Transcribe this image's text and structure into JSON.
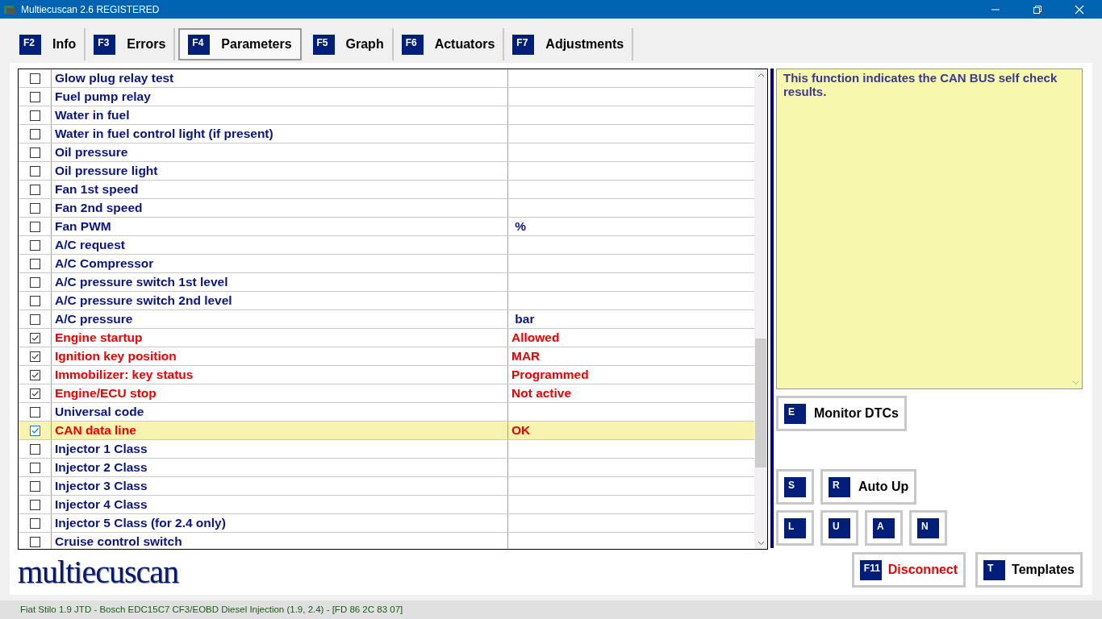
{
  "window": {
    "title": "Multiecuscan 2.6 REGISTERED"
  },
  "tabs": [
    {
      "key": "F2",
      "label": "Info",
      "selected": false
    },
    {
      "key": "F3",
      "label": "Errors",
      "selected": false
    },
    {
      "key": "F4",
      "label": "Parameters",
      "selected": true
    },
    {
      "key": "F5",
      "label": "Graph",
      "selected": false
    },
    {
      "key": "F6",
      "label": "Actuators",
      "selected": false
    },
    {
      "key": "F7",
      "label": "Adjustments",
      "selected": false
    }
  ],
  "parameters": [
    {
      "name": "Glow plug relay test",
      "checked": false,
      "selected": false
    },
    {
      "name": "Fuel pump relay",
      "checked": false,
      "selected": false
    },
    {
      "name": "Water in fuel",
      "checked": false,
      "selected": false
    },
    {
      "name": "Water in fuel control light (if present)",
      "checked": false,
      "selected": false
    },
    {
      "name": "Oil pressure",
      "checked": false,
      "selected": false
    },
    {
      "name": "Oil pressure light",
      "checked": false,
      "selected": false
    },
    {
      "name": "Fan 1st speed",
      "checked": false,
      "selected": false
    },
    {
      "name": "Fan 2nd speed",
      "checked": false,
      "selected": false
    },
    {
      "name": "Fan PWM",
      "value": " %",
      "checked": false,
      "selected": false
    },
    {
      "name": "A/C request",
      "checked": false,
      "selected": false
    },
    {
      "name": "A/C Compressor",
      "checked": false,
      "selected": false
    },
    {
      "name": "A/C pressure switch 1st level",
      "checked": false,
      "selected": false
    },
    {
      "name": "A/C pressure switch 2nd level",
      "checked": false,
      "selected": false
    },
    {
      "name": "A/C pressure",
      "value": " bar",
      "checked": false,
      "selected": false
    },
    {
      "name": "Engine startup",
      "value": "Allowed",
      "checked": true,
      "selected": false
    },
    {
      "name": "Ignition key position",
      "value": "MAR",
      "checked": true,
      "selected": false
    },
    {
      "name": "Immobilizer: key status",
      "value": "Programmed",
      "checked": true,
      "selected": false
    },
    {
      "name": "Engine/ECU stop",
      "value": "Not active",
      "checked": true,
      "selected": false
    },
    {
      "name": "Universal code",
      "checked": false,
      "selected": false
    },
    {
      "name": "CAN data line",
      "value": "OK",
      "checked": true,
      "selected": true
    },
    {
      "name": "Injector 1 Class",
      "checked": false,
      "selected": false
    },
    {
      "name": "Injector 2 Class",
      "checked": false,
      "selected": false
    },
    {
      "name": "Injector 3 Class",
      "checked": false,
      "selected": false
    },
    {
      "name": "Injector 4 Class",
      "checked": false,
      "selected": false
    },
    {
      "name": "Injector 5 Class (for 2.4 only)",
      "checked": false,
      "selected": false
    },
    {
      "name": "Cruise control switch",
      "checked": false,
      "selected": false
    }
  ],
  "description": "This function indicates the CAN BUS self check results.",
  "monitor_button": {
    "key": "E",
    "label": "Monitor DTCs"
  },
  "graph_buttons": [
    {
      "key": "S"
    },
    {
      "key": "R",
      "label": "Auto Up"
    }
  ],
  "small_buttons": [
    {
      "key": "L"
    },
    {
      "key": "U"
    },
    {
      "key": "A"
    },
    {
      "key": "N"
    }
  ],
  "bottom_buttons": [
    {
      "key": "F11",
      "label": "Disconnect",
      "kind": "danger"
    },
    {
      "key": "T",
      "label": "Templates",
      "kind": "normal"
    }
  ],
  "logo": "multiecuscan",
  "status_bar": "Fiat Stilo 1.9 JTD - Bosch EDC15C7 CF3/EOBD Diesel Injection (1.9, 2.4) - [FD 86 2C 83 07]"
}
